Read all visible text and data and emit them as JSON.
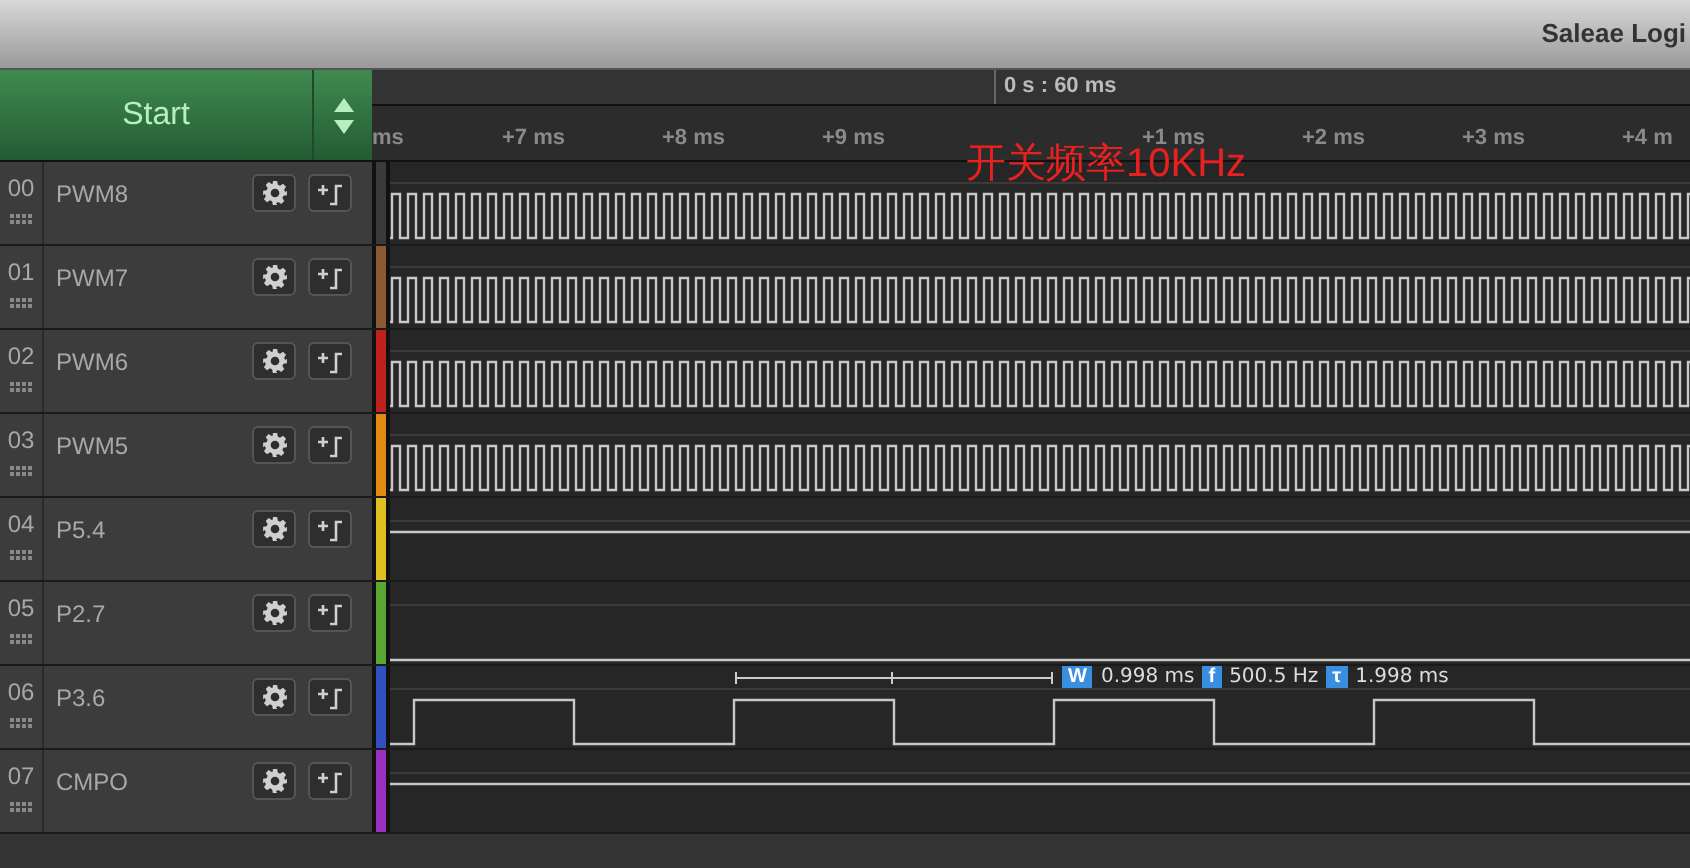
{
  "window": {
    "title": "Saleae Logi"
  },
  "start_button": {
    "label": "Start"
  },
  "timeline": {
    "position": "0 s : 60 ms",
    "ticks": [
      "ms",
      "+7 ms",
      "+8 ms",
      "+9 ms",
      "+1 ms",
      "+2 ms",
      "+3 ms",
      "+4 m"
    ]
  },
  "annotation": "开关频率10KHz",
  "channels": [
    {
      "number": "00",
      "name": "PWM8",
      "color": "#3a3a3a",
      "kind": "pwm"
    },
    {
      "number": "01",
      "name": "PWM7",
      "color": "#8a5a30",
      "kind": "pwm"
    },
    {
      "number": "02",
      "name": "PWM6",
      "color": "#c02020",
      "kind": "pwm"
    },
    {
      "number": "03",
      "name": "PWM5",
      "color": "#e08a10",
      "kind": "pwm"
    },
    {
      "number": "04",
      "name": "P5.4",
      "color": "#e0c020",
      "kind": "high"
    },
    {
      "number": "05",
      "name": "P2.7",
      "color": "#5aa830",
      "kind": "low"
    },
    {
      "number": "06",
      "name": "P3.6",
      "color": "#3050c0",
      "kind": "square",
      "measurements": [
        {
          "badge": "W",
          "value": "0.998 ms"
        },
        {
          "badge": "f",
          "value": "500.5 Hz"
        },
        {
          "badge": "τ",
          "value": "1.998 ms"
        }
      ]
    },
    {
      "number": "07",
      "name": "CMPO",
      "color": "#9a30c0",
      "kind": "high"
    }
  ]
}
